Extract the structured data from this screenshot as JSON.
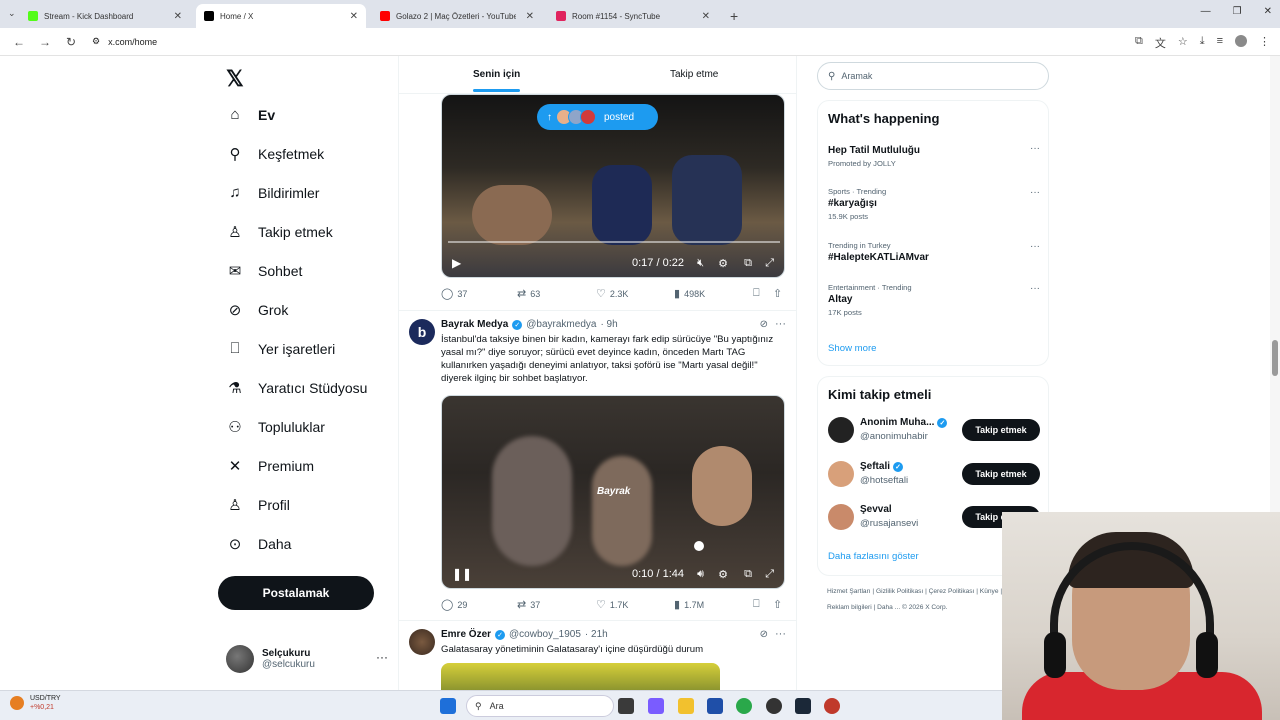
{
  "browser": {
    "tabs": [
      {
        "title": "Stream - Kick Dashboard",
        "color": "#53fc18",
        "active": false
      },
      {
        "title": "Home / X",
        "color": "#000000",
        "active": true
      },
      {
        "title": "Golazo 2 | Maç Özetleri - YouTube",
        "color": "#ff0000",
        "active": false
      },
      {
        "title": "Room #1154 - SyncTube",
        "color": "#e0245e",
        "active": false
      }
    ],
    "url": "x.com/home"
  },
  "nav": {
    "items": [
      {
        "label": "Ev",
        "icon": "home-icon",
        "glyph": "⌂",
        "bold": true
      },
      {
        "label": "Keşfetmek",
        "icon": "search-icon",
        "glyph": "⚲"
      },
      {
        "label": "Bildirimler",
        "icon": "bell-icon",
        "glyph": "♫"
      },
      {
        "label": "Takip etmek",
        "icon": "person-add-icon",
        "glyph": "♙"
      },
      {
        "label": "Sohbet",
        "icon": "mail-icon",
        "glyph": "✉"
      },
      {
        "label": "Grok",
        "icon": "grok-icon",
        "glyph": "⊘"
      },
      {
        "label": "Yer işaretleri",
        "icon": "bookmark-icon",
        "glyph": "⎕"
      },
      {
        "label": "Yaratıcı Stüdyosu",
        "icon": "flask-icon",
        "glyph": "⚗"
      },
      {
        "label": "Topluluklar",
        "icon": "communities-icon",
        "glyph": "⚇"
      },
      {
        "label": "Premium",
        "icon": "x-logo-icon",
        "glyph": "✕"
      },
      {
        "label": "Profil",
        "icon": "profile-icon",
        "glyph": "♙"
      },
      {
        "label": "Daha",
        "icon": "more-circle-icon",
        "glyph": "⊙"
      }
    ],
    "post_label": "Postalamak",
    "account": {
      "name": "Selçukuru",
      "handle": "@selcukuru"
    }
  },
  "feed": {
    "tabs": [
      "Senin için",
      "Takip etme"
    ],
    "posted_pill": "posted",
    "video1": {
      "time": "0:17 / 0:22"
    },
    "actions1": {
      "replies": "37",
      "reposts": "63",
      "likes": "2.3K",
      "views": "498K"
    },
    "tweet2": {
      "name": "Bayrak Medya",
      "handle": "@bayrakmedya",
      "time": "· 9h",
      "text": "İstanbul'da taksiye binen bir kadın, kamerayı fark edip sürücüye \"Bu yaptığınız yasal mı?\" diye soruyor; sürücü evet deyince kadın, önceden Martı TAG kullanırken yaşadığı deneyimi anlatıyor, taksi şoförü ise \"Martı yasal değil!\" diyerek ilginç bir sohbet başlatıyor.",
      "video_time": "0:10 / 1:44",
      "watermark": "Bayrak",
      "actions": {
        "replies": "29",
        "reposts": "37",
        "likes": "1.7K",
        "views": "1.7M"
      }
    },
    "tweet3": {
      "name": "Emre Özer",
      "handle": "@cowboy_1905",
      "time": "· 21h",
      "text": "Galatasaray yönetiminin Galatasaray'ı içine düşürdüğü durum"
    }
  },
  "sidebar": {
    "search_placeholder": "Aramak",
    "happening_title": "What's happening",
    "trends": [
      {
        "meta": "",
        "name": "Hep Tatil Mutluluğu",
        "sub": "Promoted by JOLLY"
      },
      {
        "meta": "Sports · Trending",
        "name": "#karyağışı",
        "sub": "15.9K posts"
      },
      {
        "meta": "Trending in Turkey",
        "name": "#HaleptеKATLiAMvar",
        "sub": ""
      },
      {
        "meta": "Entertainment · Trending",
        "name": "Altay",
        "sub": "17K posts"
      }
    ],
    "show_more": "Show more",
    "who_title": "Kimi takip etmeli",
    "who": [
      {
        "name": "Anonim Muha...",
        "handle": "@anonimuhabir",
        "follow": "Takip etmek"
      },
      {
        "name": "Şeftali",
        "handle": "@hotseftali",
        "follow": "Takip etmek"
      },
      {
        "name": "Şevval",
        "handle": "@rusajansevi",
        "follow": "Takip etmek"
      }
    ],
    "who_more": "Daha fazlasını göster",
    "footer": "Hizmet Şartları | Gizlilik Politikası | Çerez Politikası | Künye | Erişilebilirlik | Reklam bilgileri | Daha ... © 2026 X Corp."
  },
  "taskbar": {
    "ticker": "USD/TRY",
    "change": "+%0,21",
    "search": "Ara"
  }
}
